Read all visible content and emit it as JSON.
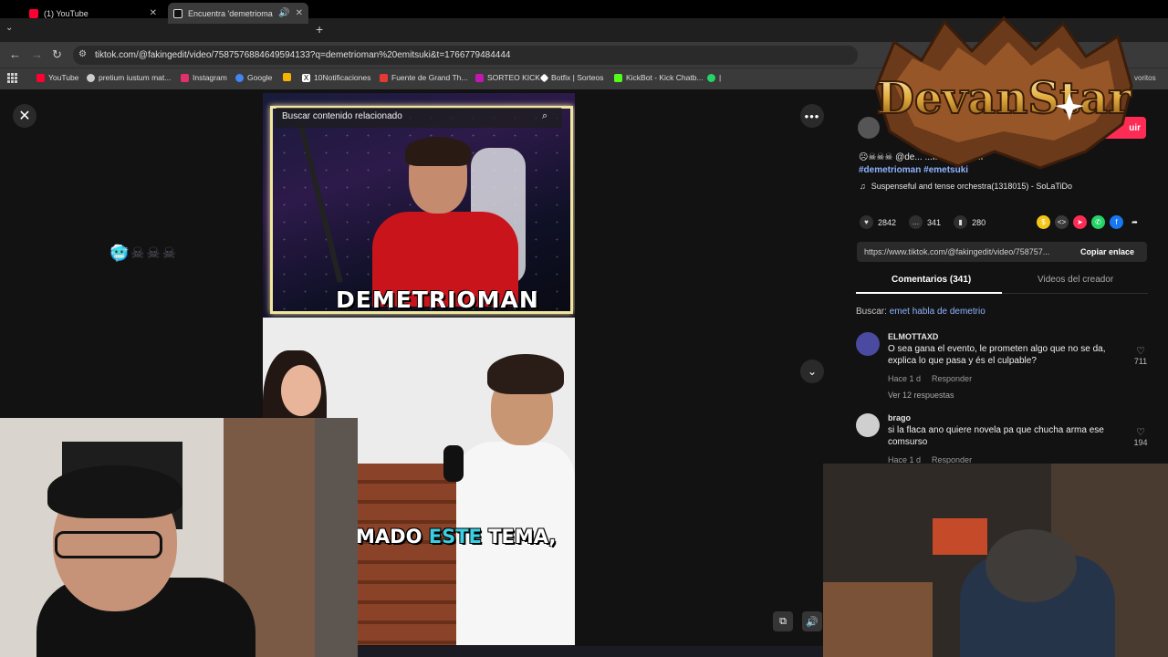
{
  "browser": {
    "tabs": [
      {
        "title": "(1) YouTube",
        "active": false,
        "favicon_color": "#ff0033"
      },
      {
        "title": "Encuentra 'demetrioman en",
        "active": true,
        "favicon_color": "#ffffff"
      }
    ],
    "url": "tiktok.com/@fakingedit/video/7587576884649594133?q=demetrioman%20emitsuki&t=1766779484444",
    "bookmarks": [
      {
        "label": "YouTube",
        "color": "#ff0033"
      },
      {
        "label": "pretium iustum mat...",
        "color": "#cccccc"
      },
      {
        "label": "Instagram",
        "color": "#e1306c"
      },
      {
        "label": "Google",
        "color": "#4285f4"
      },
      {
        "label": "",
        "color": "#f4b400"
      },
      {
        "label": "10Notificaciones",
        "color": "#ffffff"
      },
      {
        "label": "Fuente de Grand Th...",
        "color": "#e53935"
      },
      {
        "label": "SORTEO KICK",
        "color": "#c218b2"
      },
      {
        "label": "Botfix | Sorteos",
        "color": "#ffffff"
      },
      {
        "label": "KickBot - Kick Chatb...",
        "color": "#53fc18"
      },
      {
        "label": "|",
        "color": "#25d366"
      }
    ],
    "bookmarks_end": "voritos"
  },
  "video": {
    "search_placeholder": "Buscar contenido relacionado",
    "banner": "DEMETRIOMAN",
    "emoji_row": "🥶☠☠☠",
    "subtitle_pre": "MADO ",
    "subtitle_highlight": "ESTE",
    "subtitle_post": " TEMA,"
  },
  "panel": {
    "follow_label": "uir",
    "description_prefix": "☹☠☠☠ @de...  ...IIIIIIIIIIIIIIIIIIII",
    "hashtags": "#demetrioman #emetsuki",
    "music": "Suspenseful and tense orchestra(1318015) - SoLaTiDo",
    "likes": "2842",
    "comments_count": "341",
    "saves": "280",
    "link": "https://www.tiktok.com/@fakingedit/video/758757...",
    "copy_label": "Copiar enlace",
    "tab_comments": "Comentarios (341)",
    "tab_creator": "Videos del creador",
    "search_label": "Buscar:",
    "search_query": "emet habla de demetrio",
    "comments": [
      {
        "user": "ELMOTTAXD",
        "text": "O sea gana el evento, le prometen algo que no se da, explica lo que pasa y és el culpable?",
        "time": "Hace 1 d",
        "reply": "Responder",
        "likes": "711",
        "replies": "Ver 12 respuestas",
        "avatar_color": "#4a4aa0"
      },
      {
        "user": "brago",
        "text": "si la flaca ano quiere novela pa que chucha arma ese comsurso",
        "time": "Hace 1 d",
        "reply": "Responder",
        "likes": "194",
        "avatar_color": "#cfcfcf"
      }
    ]
  },
  "overlay": {
    "logo_text": "DevanStar"
  }
}
